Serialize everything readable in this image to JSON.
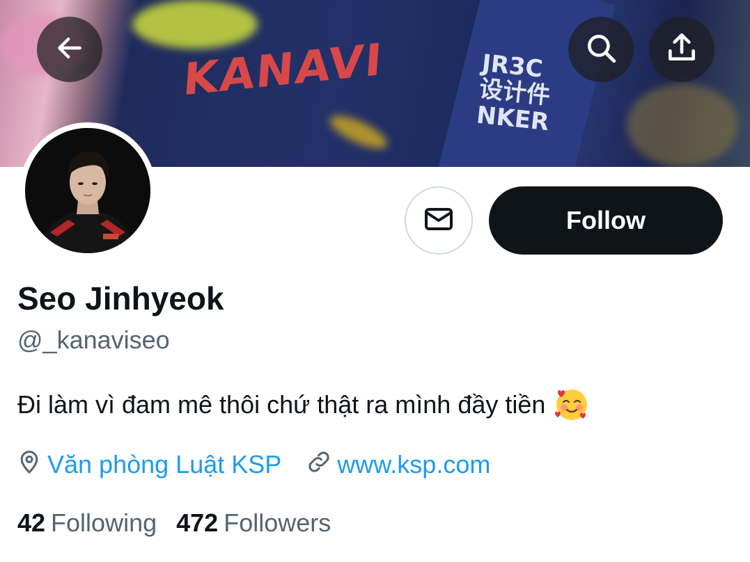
{
  "header": {
    "back_icon": "arrow-left-icon",
    "search_icon": "search-icon",
    "share_icon": "share-upload-icon",
    "banner_jersey_text": "KANAVI",
    "banner_sponsor_text": "JR3C\n设计件\nNKER"
  },
  "profile": {
    "name": "Seo Jinhyeok",
    "handle": "@_kanaviseo",
    "bio": "Đi làm vì đam mê thôi chứ thật ra mình đầy tiền",
    "bio_emoji": "smiling-face-with-hearts",
    "location": "Văn phòng Luật KSP",
    "website": "www.ksp.com"
  },
  "actions": {
    "message_icon": "mail-icon",
    "follow_label": "Follow"
  },
  "stats": {
    "following_count": "42",
    "following_label": "Following",
    "followers_count": "472",
    "followers_label": "Followers"
  },
  "colors": {
    "link": "#1d9bf0",
    "secondary_text": "#536471",
    "primary_text": "#0f1419",
    "follow_bg": "#0f1419"
  }
}
